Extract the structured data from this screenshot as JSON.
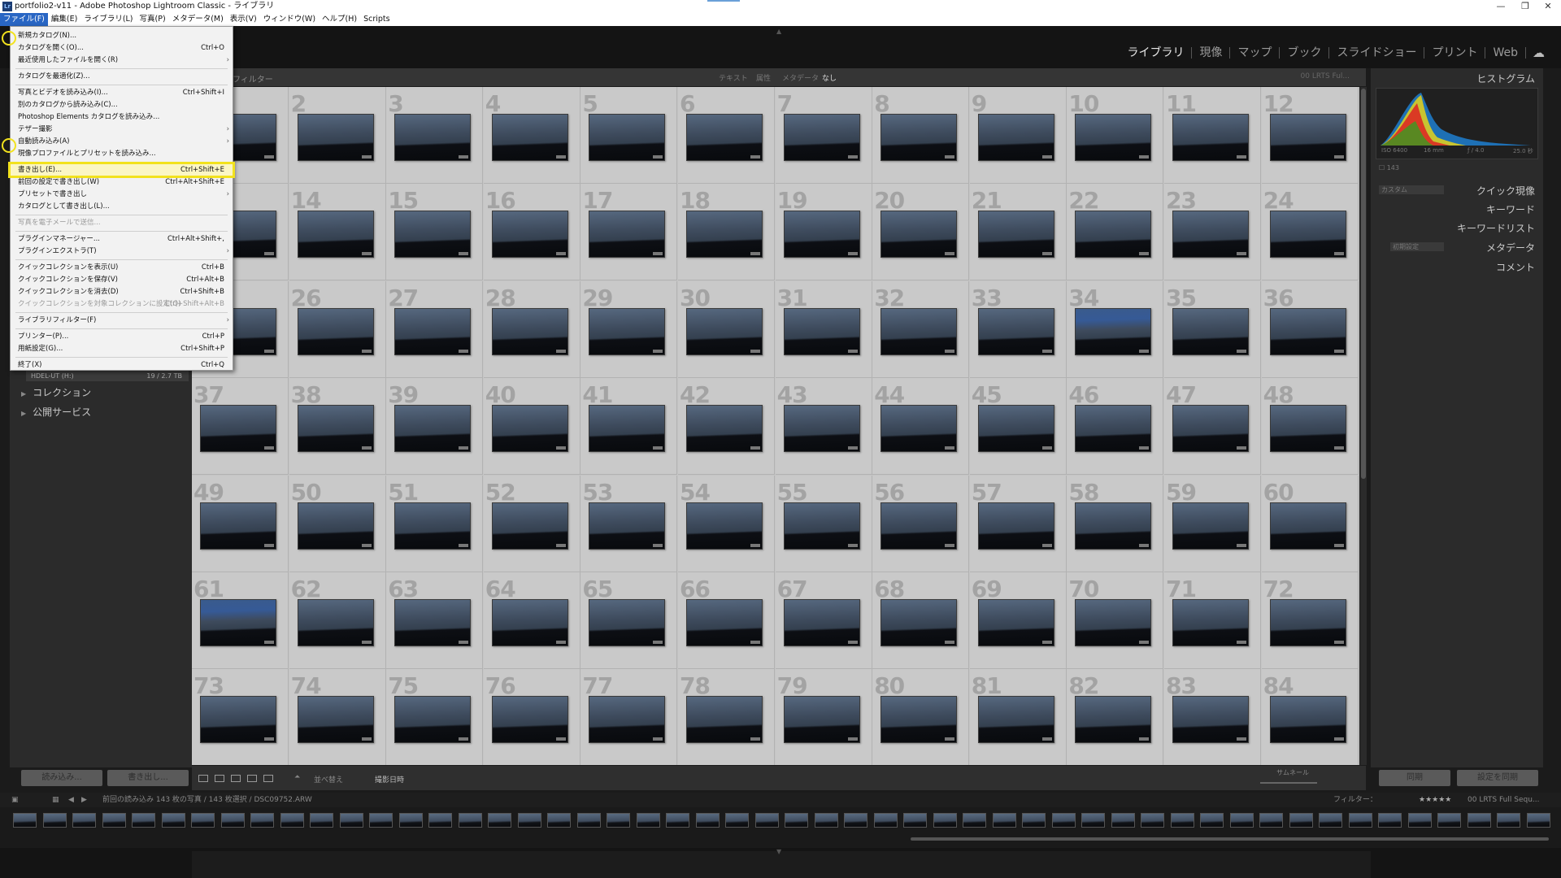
{
  "window": {
    "title": "portfolio2-v11 - Adobe Photoshop Lightroom Classic - ライブラリ"
  },
  "menubar": [
    "ファイル(F)",
    "編集(E)",
    "ライブラリ(L)",
    "写真(P)",
    "メタデータ(M)",
    "表示(V)",
    "ウィンドウ(W)",
    "ヘルプ(H)",
    "Scripts"
  ],
  "modules": [
    "ライブラリ",
    "現像",
    "マップ",
    "ブック",
    "スライドショー",
    "プリント",
    "Web"
  ],
  "file_menu": [
    {
      "label": "新規カタログ(N)...",
      "shortcut": ""
    },
    {
      "label": "カタログを開く(O)...",
      "shortcut": "Ctrl+O"
    },
    {
      "label": "最近使用したファイルを開く(R)",
      "shortcut": "",
      "submenu": true
    },
    {
      "sep": true
    },
    {
      "label": "カタログを最適化(Z)...",
      "shortcut": ""
    },
    {
      "sep": true
    },
    {
      "label": "写真とビデオを読み込み(I)...",
      "shortcut": "Ctrl+Shift+I"
    },
    {
      "label": "別のカタログから読み込み(C)...",
      "shortcut": ""
    },
    {
      "label": "Photoshop Elements カタログを読み込み...",
      "shortcut": ""
    },
    {
      "label": "テザー撮影",
      "shortcut": "",
      "submenu": true
    },
    {
      "label": "自動読み込み(A)",
      "shortcut": "",
      "submenu": true
    },
    {
      "label": "現像プロファイルとプリセットを読み込み...",
      "shortcut": ""
    },
    {
      "sep": true
    },
    {
      "label": "書き出し(E)...",
      "shortcut": "Ctrl+Shift+E",
      "highlight": true
    },
    {
      "label": "前回の設定で書き出し(W)",
      "shortcut": "Ctrl+Alt+Shift+E"
    },
    {
      "label": "プリセットで書き出し",
      "shortcut": "",
      "submenu": true
    },
    {
      "label": "カタログとして書き出し(L)...",
      "shortcut": ""
    },
    {
      "sep": true
    },
    {
      "label": "写真を電子メールで送信...",
      "shortcut": "",
      "disabled": true
    },
    {
      "sep": true
    },
    {
      "label": "プラグインマネージャー...",
      "shortcut": "Ctrl+Alt+Shift+,"
    },
    {
      "label": "プラグインエクストラ(T)",
      "shortcut": "",
      "submenu": true
    },
    {
      "sep": true
    },
    {
      "label": "クイックコレクションを表示(U)",
      "shortcut": "Ctrl+B"
    },
    {
      "label": "クイックコレクションを保存(V)",
      "shortcut": "Ctrl+Alt+B"
    },
    {
      "label": "クイックコレクションを消去(D)",
      "shortcut": "Ctrl+Shift+B"
    },
    {
      "label": "クイックコレクションを対象コレクションに設定(Q)",
      "shortcut": "Ctrl+Shift+Alt+B",
      "disabled": true
    },
    {
      "sep": true
    },
    {
      "label": "ライブラリフィルター(F)",
      "shortcut": "",
      "submenu": true
    },
    {
      "sep": true
    },
    {
      "label": "プリンター(P)...",
      "shortcut": "Ctrl+P"
    },
    {
      "label": "用紙設定(G)...",
      "shortcut": "Ctrl+Shift+P"
    },
    {
      "sep": true
    },
    {
      "label": "終了(X)",
      "shortcut": "Ctrl+Q"
    }
  ],
  "filterbar": {
    "label": "フィルター",
    "tabs": [
      "テキスト",
      "属性",
      "メタデータ",
      "なし"
    ],
    "preset": "00 LRTS Ful..."
  },
  "left_panel": {
    "hdd": "HDEL-UT (H:)",
    "hdd_info": "19 / 2.7 TB",
    "collections": "コレクション",
    "publish": "公開サービス",
    "import_btn": "読み込み...",
    "export_btn": "書き出し..."
  },
  "right_panel": {
    "histogram": "ヒストグラム",
    "hist_info": [
      "ISO 6400",
      "16 mm",
      "ƒ / 4.0",
      "25.0 秒"
    ],
    "hist_small": "☐ 143",
    "quick_dev": "クイック現像",
    "quick_dev_preset": "カスタム",
    "keyword": "キーワード",
    "keyword_list": "キーワードリスト",
    "metadata": "メタデータ",
    "metadata_preset": "初期設定",
    "comment": "コメント",
    "sync_btn": "同期",
    "sync_settings_btn": "設定を同期"
  },
  "toolbar": {
    "sort_label": "並べ替え",
    "sort_value": "撮影日時",
    "thumb_label": "サムネール"
  },
  "statusbar": {
    "path": "前回の読み込み 143 枚の写真 / 143 枚選択 / DSC09752.ARW",
    "filter_label": "フィルター：",
    "preset": "00 LRTS Full Sequ..."
  },
  "grid": {
    "start": 1,
    "end": 84,
    "columns": 12,
    "blue_cells": [
      34,
      61
    ]
  }
}
